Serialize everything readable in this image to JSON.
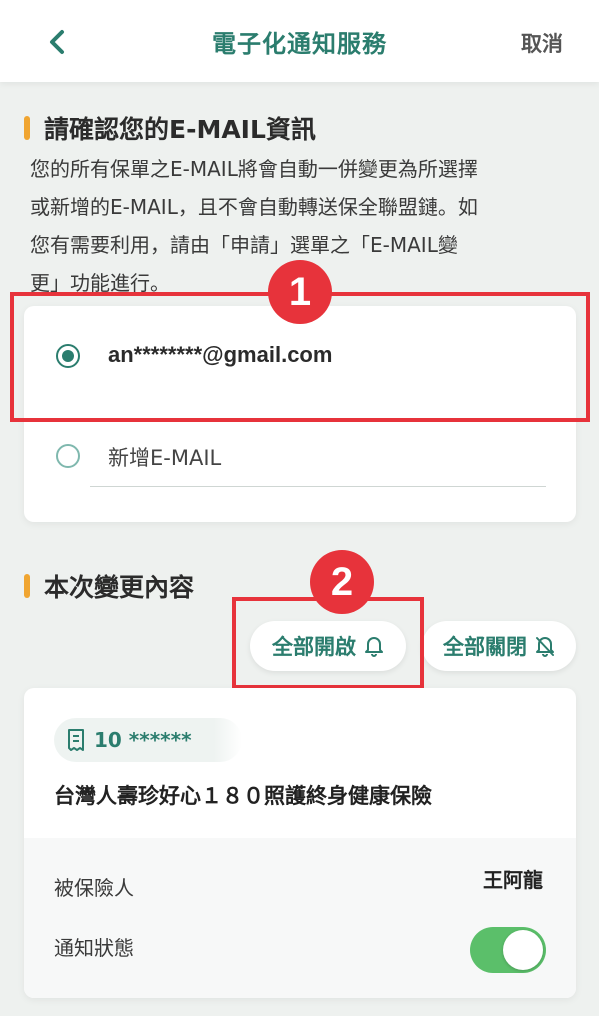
{
  "header": {
    "title": "電子化通知服務",
    "cancel_label": "取消"
  },
  "email_section": {
    "title": "請確認您的E-MAIL資訊",
    "notice_lines": [
      "您的所有保單之E-MAIL將會自動一併變更為所選擇",
      "或新增的E-MAIL，且不會自動轉送保全聯盟鏈。如",
      "您有需要利用，請由「申請」選單之「E-MAIL變",
      "更」功能進行。"
    ],
    "options": [
      {
        "label": "an********@gmail.com",
        "selected": true
      },
      {
        "label": "新增E-MAIL",
        "selected": false
      }
    ]
  },
  "changes_section": {
    "title": "本次變更內容",
    "enable_all_label": "全部開啟",
    "disable_all_label": "全部關閉"
  },
  "policy": {
    "number": "10 ******",
    "name": "台灣人壽珍好心１８０照護終身健康保險",
    "insured_label": "被保險人",
    "insured_value": "王阿龍",
    "notify_label": "通知狀態",
    "notify_on": true
  },
  "annotations": {
    "marker_1": "1",
    "marker_2": "2"
  },
  "colors": {
    "brand": "#2b7d6e",
    "accent_bar": "#f0a531",
    "annotation": "#e7333b",
    "toggle_on": "#5bbf6a"
  }
}
